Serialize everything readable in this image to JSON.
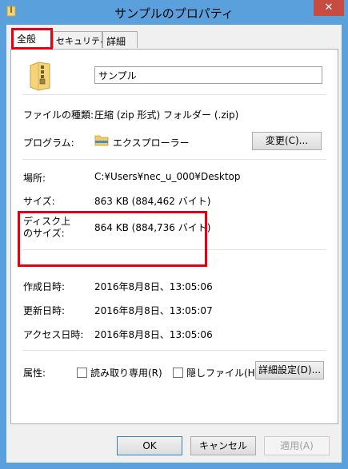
{
  "window": {
    "title": "サンプルのプロパティ",
    "close_label": "✕"
  },
  "tabs": [
    {
      "label": "全般",
      "active": true
    },
    {
      "label": "セキュリティ",
      "active": false
    },
    {
      "label": "詳細",
      "active": false
    }
  ],
  "general": {
    "file_name": "サンプル",
    "type": {
      "label": "ファイルの種類:",
      "value": "圧縮 (zip 形式) フォルダー (.zip)"
    },
    "program": {
      "label": "プログラム:",
      "value": "エクスプローラー",
      "change_button": "変更(C)..."
    },
    "location": {
      "label": "場所:",
      "value": "C:¥Users¥nec_u_000¥Desktop"
    },
    "size": {
      "label": "サイズ:",
      "value": "863 KB (884,462 バイト)"
    },
    "size_on_disk": {
      "label_line1": "ディスク上",
      "label_line2": "のサイズ:",
      "value": "864 KB (884,736 バイト)"
    },
    "created": {
      "label": "作成日時:",
      "value": "2016年8月8日、13:05:06"
    },
    "modified": {
      "label": "更新日時:",
      "value": "2016年8月8日、13:05:07"
    },
    "accessed": {
      "label": "アクセス日時:",
      "value": "2016年8月8日、13:05:06"
    },
    "attributes": {
      "label": "属性:",
      "readonly": "読み取り専用(R)",
      "hidden": "隠しファイル(H)",
      "advanced_button": "詳細設定(D)..."
    }
  },
  "footer": {
    "ok": "OK",
    "cancel": "キャンセル",
    "apply": "適用(A)"
  },
  "colors": {
    "highlight": "#e60012",
    "title_bar": "#5aa0dd",
    "close_button": "#c74b41"
  }
}
